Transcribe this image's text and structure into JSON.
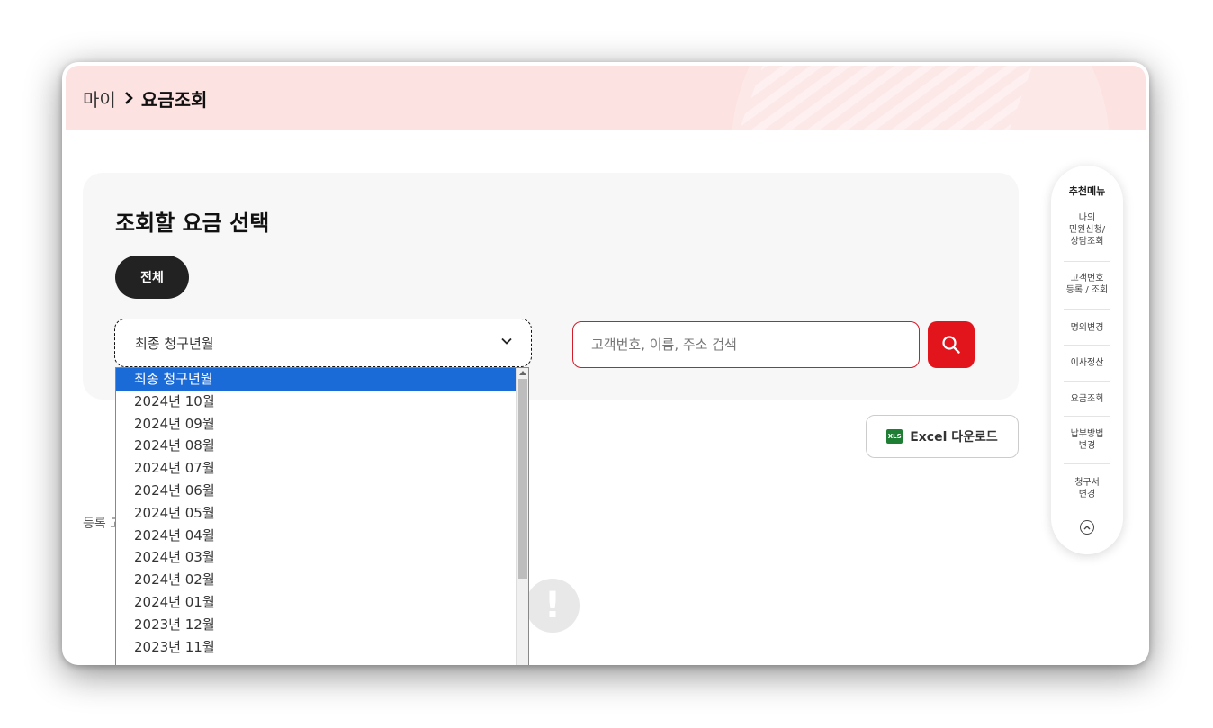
{
  "header": {
    "breadcrumb_parent": "마이",
    "breadcrumb_current": "요금조회"
  },
  "panel": {
    "title": "조회할 요금 선택",
    "all_button": "전체",
    "select_value": "최종 청구년월",
    "search_placeholder": "고객번호, 이름, 주소 검색"
  },
  "excel_button": {
    "icon_text": "XLS",
    "label": "Excel 다운로드"
  },
  "registered_text": "등록 고",
  "alert_glyph": "!",
  "dropdown": {
    "options": [
      "최종 청구년월",
      "2024년 10월",
      "2024년 09월",
      "2024년 08월",
      "2024년 07월",
      "2024년 06월",
      "2024년 05월",
      "2024년 04월",
      "2024년 03월",
      "2024년 02월",
      "2024년 01월",
      "2023년 12월",
      "2023년 11월"
    ],
    "selected_index": 0
  },
  "side_menu": {
    "title": "추천메뉴",
    "items": [
      "나의\n민원신청/\n상담조회",
      "고객번호\n등록 / 조회",
      "명의변경",
      "이사정산",
      "요금조회",
      "납부방법\n변경",
      "청구서\n변경"
    ]
  },
  "colors": {
    "accent_red": "#e2141c",
    "header_pink": "#fde2e2",
    "selected_blue": "#1a6ad8"
  }
}
